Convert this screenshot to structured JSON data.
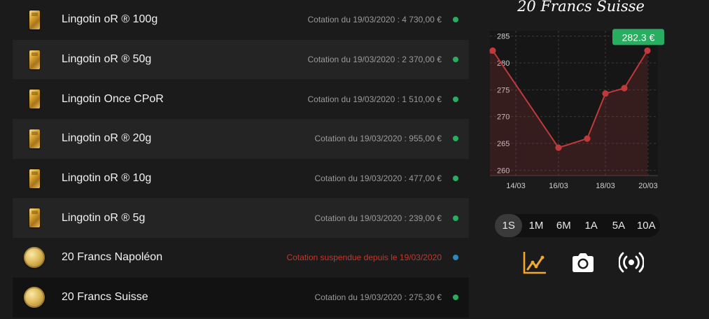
{
  "products": [
    {
      "name": "Lingotin oR ® 100g",
      "quote": "Cotation du 19/03/2020 : 4 730,00 €",
      "icon": "gold-bar-icon",
      "status": "green"
    },
    {
      "name": "Lingotin oR ® 50g",
      "quote": "Cotation du 19/03/2020 : 2 370,00 €",
      "icon": "gold-bar-icon",
      "status": "green"
    },
    {
      "name": "Lingotin Once CPoR",
      "quote": "Cotation du 19/03/2020 : 1 510,00 €",
      "icon": "gold-bar-icon",
      "status": "green"
    },
    {
      "name": "Lingotin oR ® 20g",
      "quote": "Cotation du 19/03/2020 : 955,00 €",
      "icon": "gold-bar-icon",
      "status": "green"
    },
    {
      "name": "Lingotin oR ® 10g",
      "quote": "Cotation du 19/03/2020 : 477,00 €",
      "icon": "gold-bar-icon",
      "status": "green"
    },
    {
      "name": "Lingotin oR ® 5g",
      "quote": "Cotation du 19/03/2020 : 239,00 €",
      "icon": "gold-bar-icon",
      "status": "green"
    },
    {
      "name": "20 Francs Napoléon",
      "quote": "Cotation suspendue depuis le 19/03/2020",
      "icon": "gold-coin-icon",
      "status": "blue"
    },
    {
      "name": "20 Francs Suisse",
      "quote": "Cotation du 19/03/2020 : 275,30 €",
      "icon": "gold-coin-icon",
      "status": "green"
    }
  ],
  "selected_index": 7,
  "panel": {
    "title": "20 Francs Suisse",
    "price_badge": "282.3 €"
  },
  "chart_data": {
    "type": "line",
    "title": "20 Francs Suisse",
    "x": [
      "13/03",
      "16/03",
      "17/03",
      "18/03",
      "19/03",
      "20/03"
    ],
    "y": [
      282.3,
      264.2,
      265.9,
      274.3,
      275.3,
      282.3
    ],
    "x_ticks": [
      "14/03",
      "16/03",
      "18/03",
      "20/03"
    ],
    "y_ticks": [
      260,
      265,
      270,
      275,
      280,
      285
    ],
    "ylim": [
      259,
      286
    ],
    "grid": true,
    "line_color": "#c0393b",
    "badge_color": "#27ae60"
  },
  "periods": [
    "1S",
    "1M",
    "6M",
    "1A",
    "5A",
    "10A"
  ],
  "active_period": "1S",
  "tools": [
    {
      "name": "chart-icon",
      "color": "#f0a830"
    },
    {
      "name": "camera-icon",
      "color": "#ffffff"
    },
    {
      "name": "live-broadcast-icon",
      "color": "#ffffff"
    }
  ]
}
